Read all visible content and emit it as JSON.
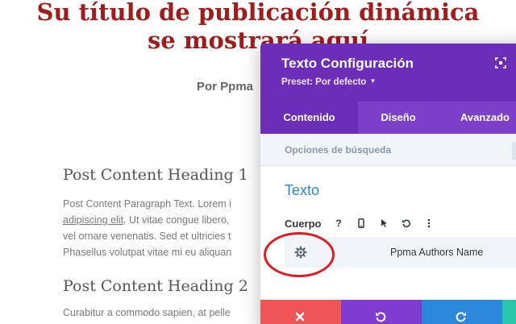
{
  "page": {
    "title": "Su título de publicación dinámica se mostrará aquí",
    "byline": "Por Ppma",
    "sections": [
      {
        "heading": "Post Content Heading 1",
        "paragraph_lines": [
          {
            "text": "Post Content Paragraph Text. Lorem i",
            "underlined": ""
          },
          {
            "text": "",
            "underlined": "adipiscing elit",
            "after": ". Ut vitae congue libero,"
          },
          {
            "text": "vel ornare venenatis. Sed et ultricies t",
            "underlined": ""
          },
          {
            "text": "Phasellus volutpat vitae mi eu aliquan",
            "underlined": ""
          }
        ]
      },
      {
        "heading": "Post Content Heading 2",
        "paragraph_lines": [
          {
            "text": "Curabitur a commodo sapien, at pelle",
            "underlined": ""
          }
        ]
      }
    ]
  },
  "modal": {
    "title": "Texto Configuración",
    "preset_label": "Preset: Por defecto",
    "tabs": [
      {
        "label": "Contenido",
        "active": true
      },
      {
        "label": "Diseño",
        "active": false
      },
      {
        "label": "Avanzado",
        "active": false
      }
    ],
    "search_placeholder": "Opciones de búsqueda",
    "section_title": "Texto",
    "field_label": "Cuerpo",
    "help_glyph": "?",
    "dynamic_content_name": "Ppma Authors Name"
  },
  "colors": {
    "title_red": "#a11d1d",
    "header_purple": "#6c2eb9",
    "tabs_purple": "#7d3fc9",
    "section_blue": "#2b87da",
    "annotation_red": "#e11b22",
    "cancel": "#ef5555",
    "undo": "#7e3bd0",
    "redo": "#2b87da",
    "save": "#29c4a9"
  },
  "icons": {
    "expand": "expand-icon",
    "help": "help-icon",
    "responsive": "phone-icon",
    "hover": "cursor-icon",
    "reset": "reset-icon",
    "more": "more-icon",
    "dynamic": "gear-icon",
    "cancel": "close-icon",
    "undo": "undo-icon",
    "redo": "redo-icon"
  }
}
